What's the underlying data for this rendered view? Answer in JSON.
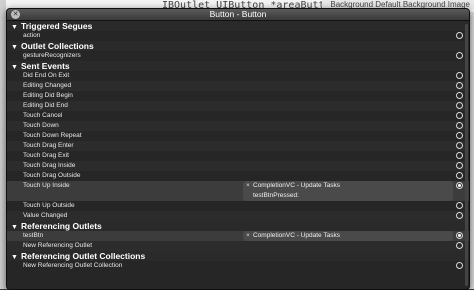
{
  "background": {
    "code_line": "IBOutlet UIButton *areaButton;",
    "right_text": "Background  Default Background Image"
  },
  "panel": {
    "title": "Button - Button",
    "sections": [
      {
        "title": "Triggered Segues",
        "rows": [
          {
            "label": "action"
          }
        ]
      },
      {
        "title": "Outlet Collections",
        "rows": [
          {
            "label": "gestureRecognizers"
          }
        ]
      },
      {
        "title": "Sent Events",
        "rows": [
          {
            "label": "Did End On Exit"
          },
          {
            "label": "Editing Changed"
          },
          {
            "label": "Editing Did Begin"
          },
          {
            "label": "Editing Did End"
          },
          {
            "label": "Touch Cancel"
          },
          {
            "label": "Touch Down"
          },
          {
            "label": "Touch Down Repeat"
          },
          {
            "label": "Touch Drag Enter"
          },
          {
            "label": "Touch Drag Exit"
          },
          {
            "label": "Touch Drag Inside"
          },
          {
            "label": "Touch Drag Outside"
          },
          {
            "label": "Touch Up Inside",
            "connection": [
              "CompletionVC - Update Tasks",
              "testBtnPressed:"
            ]
          },
          {
            "label": "Touch Up Outside"
          },
          {
            "label": "Value Changed"
          }
        ]
      },
      {
        "title": "Referencing Outlets",
        "rows": [
          {
            "label": "testBtn",
            "connection": [
              "CompletionVC - Update Tasks"
            ]
          },
          {
            "label": "New Referencing Outlet"
          }
        ]
      },
      {
        "title": "Referencing Outlet Collections",
        "rows": [
          {
            "label": "New Referencing Outlet Collection"
          }
        ]
      }
    ]
  },
  "icons": {
    "close": "close-icon",
    "disclosure": "disclosure-triangle-icon",
    "connector": "connector-circle-icon"
  }
}
